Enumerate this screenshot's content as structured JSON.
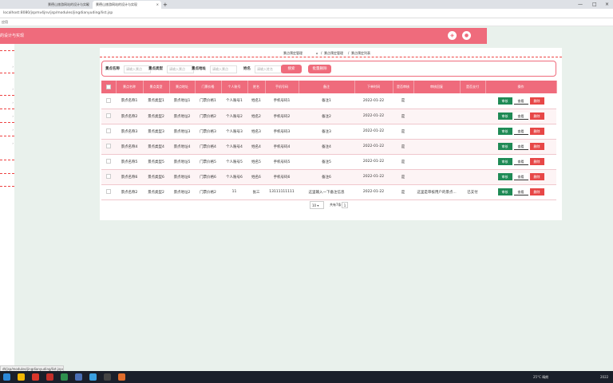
{
  "browser": {
    "tab1": "景德山旅游网站的设计与实现",
    "tab2": "景德山旅游网站的设计与实现",
    "close": "×",
    "new_tab": "+",
    "minimize": "—",
    "maximize": "□",
    "url": "localhost:8080/jspmv4jnv/jsp/modules/jingdianyuding/list.jsp",
    "bookmark": "应用"
  },
  "header": {
    "title": "的设计与实现"
  },
  "breadcrumb": {
    "text": "景点预定管理",
    "sep": "/",
    "home_icon": "⌂",
    "level1": "景点预定管理",
    "level2": "景点预定列表"
  },
  "filter": {
    "name_label": "景点名称",
    "name_placeholder": "请输入景点",
    "type_label": "景点类型",
    "type_placeholder": "请输入景点",
    "addr_label": "景点地址",
    "addr_placeholder": "请输入景点",
    "person_label": "姓名",
    "person_placeholder": "请输入姓名",
    "search_btn": "搜索",
    "batch_delete_btn": "批量删除"
  },
  "table": {
    "headers": [
      "景点名称",
      "景点类型",
      "景点地址",
      "门票价格",
      "个人账号",
      "姓名",
      "手机号码",
      "备注",
      "下单时间",
      "是否审核",
      "审核回复",
      "是否支付",
      "操作"
    ],
    "rows": [
      [
        "景点名称1",
        "景点类型1",
        "景点地址1",
        "门票价格1",
        "个人账号1",
        "姓名1",
        "手机号码1",
        "备注1",
        "2022-01-22",
        "是",
        "",
        ""
      ],
      [
        "景点名称2",
        "景点类型2",
        "景点地址2",
        "门票价格2",
        "个人账号2",
        "姓名2",
        "手机号码2",
        "备注2",
        "2022-01-22",
        "是",
        "",
        ""
      ],
      [
        "景点名称3",
        "景点类型3",
        "景点地址3",
        "门票价格3",
        "个人账号3",
        "姓名3",
        "手机号码3",
        "备注3",
        "2022-01-22",
        "是",
        "",
        ""
      ],
      [
        "景点名称4",
        "景点类型4",
        "景点地址4",
        "门票价格4",
        "个人账号4",
        "姓名4",
        "手机号码4",
        "备注4",
        "2022-01-22",
        "是",
        "",
        ""
      ],
      [
        "景点名称5",
        "景点类型5",
        "景点地址5",
        "门票价格5",
        "个人账号5",
        "姓名5",
        "手机号码5",
        "备注5",
        "2022-01-22",
        "是",
        "",
        ""
      ],
      [
        "景点名称6",
        "景点类型6",
        "景点地址6",
        "门票价格6",
        "个人账号6",
        "姓名6",
        "手机号码6",
        "备注6",
        "2022-01-22",
        "是",
        "",
        ""
      ],
      [
        "景点名称2",
        "景点类型2",
        "景点地址2",
        "门票价格2",
        "11",
        "张三",
        "13111111111",
        "这里输入一下备注信息",
        "2022-01-22",
        "是",
        "这里是审核用户的景点...",
        "已支付"
      ]
    ],
    "edit_btn": "审核",
    "view_btn": "查看",
    "delete_btn": "删除"
  },
  "pager": {
    "page_size": "10",
    "total": "共有7条",
    "current_page": "1"
  },
  "statusbar": {
    "url": "dt/jsp/modules/jingdianyuding/list.jsp#"
  },
  "taskbar": {
    "weather": "25°C 晴朗",
    "time": "2022"
  },
  "colors": {
    "accent": "#ef6b7c",
    "edit": "#1f8a55",
    "delete": "#e74747"
  }
}
